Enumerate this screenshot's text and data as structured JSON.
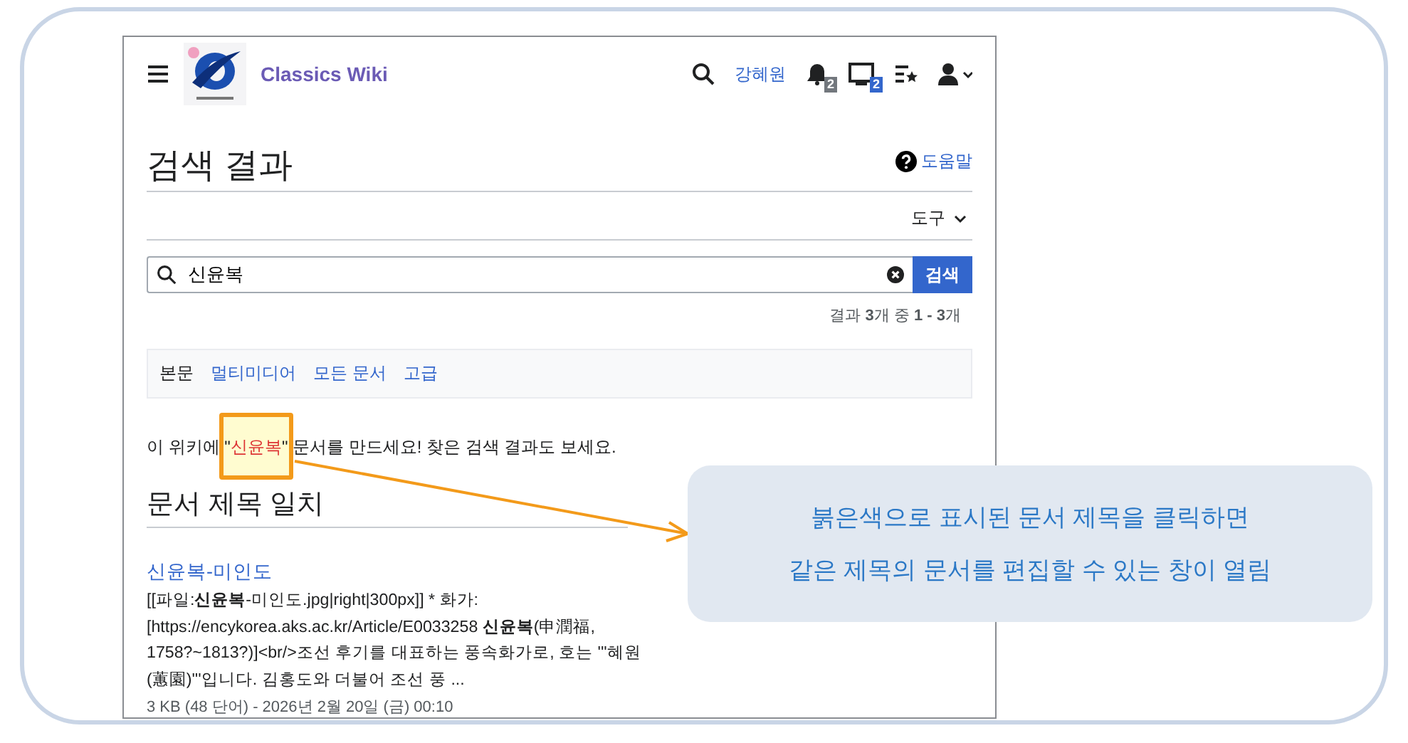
{
  "header": {
    "brand": "Classics Wiki",
    "user": "강혜원",
    "alerts_count": "2",
    "notices_count": "2"
  },
  "page": {
    "title": "검색 결과",
    "help": "도움말",
    "tools": "도구"
  },
  "search": {
    "value": "신윤복",
    "button": "검색",
    "summary": "결과 **3**개 중 **1 - 3**개"
  },
  "tabs": [
    {
      "label": "본문",
      "selected": true
    },
    {
      "label": "멀티미디어",
      "selected": false
    },
    {
      "label": "모든 문서",
      "selected": false
    },
    {
      "label": "고급",
      "selected": false
    }
  ],
  "notice": {
    "before": "이 위키에 \"",
    "link": "신윤복",
    "after": "\" 문서를 만드세요! 찾은 검색 결과도 보세요."
  },
  "section": "문서 제목 일치",
  "results": [
    {
      "title": "신윤복-미인도",
      "snippet": "[[파일:**신윤복**-미인도.jpg|right|300px]] * 화가: [https://encykorea.aks.ac.kr/Article/E0033258 **신윤복**(申潤福, 1758?~1813?)]<br/>조선 후기를 대표하는 풍속화가로, 호는 '''혜원(蕙園)'''입니다. 김홍도와 더불어 조선 풍 ...",
      "meta": "3 KB (48 단어) - 2026년 2월 20일 (금) 00:10"
    }
  ],
  "callout": [
    "붉은색으로 표시된 문서 제목을 클릭하면",
    "같은 제목의 문서를 편집할 수 있는 창이 열림"
  ]
}
